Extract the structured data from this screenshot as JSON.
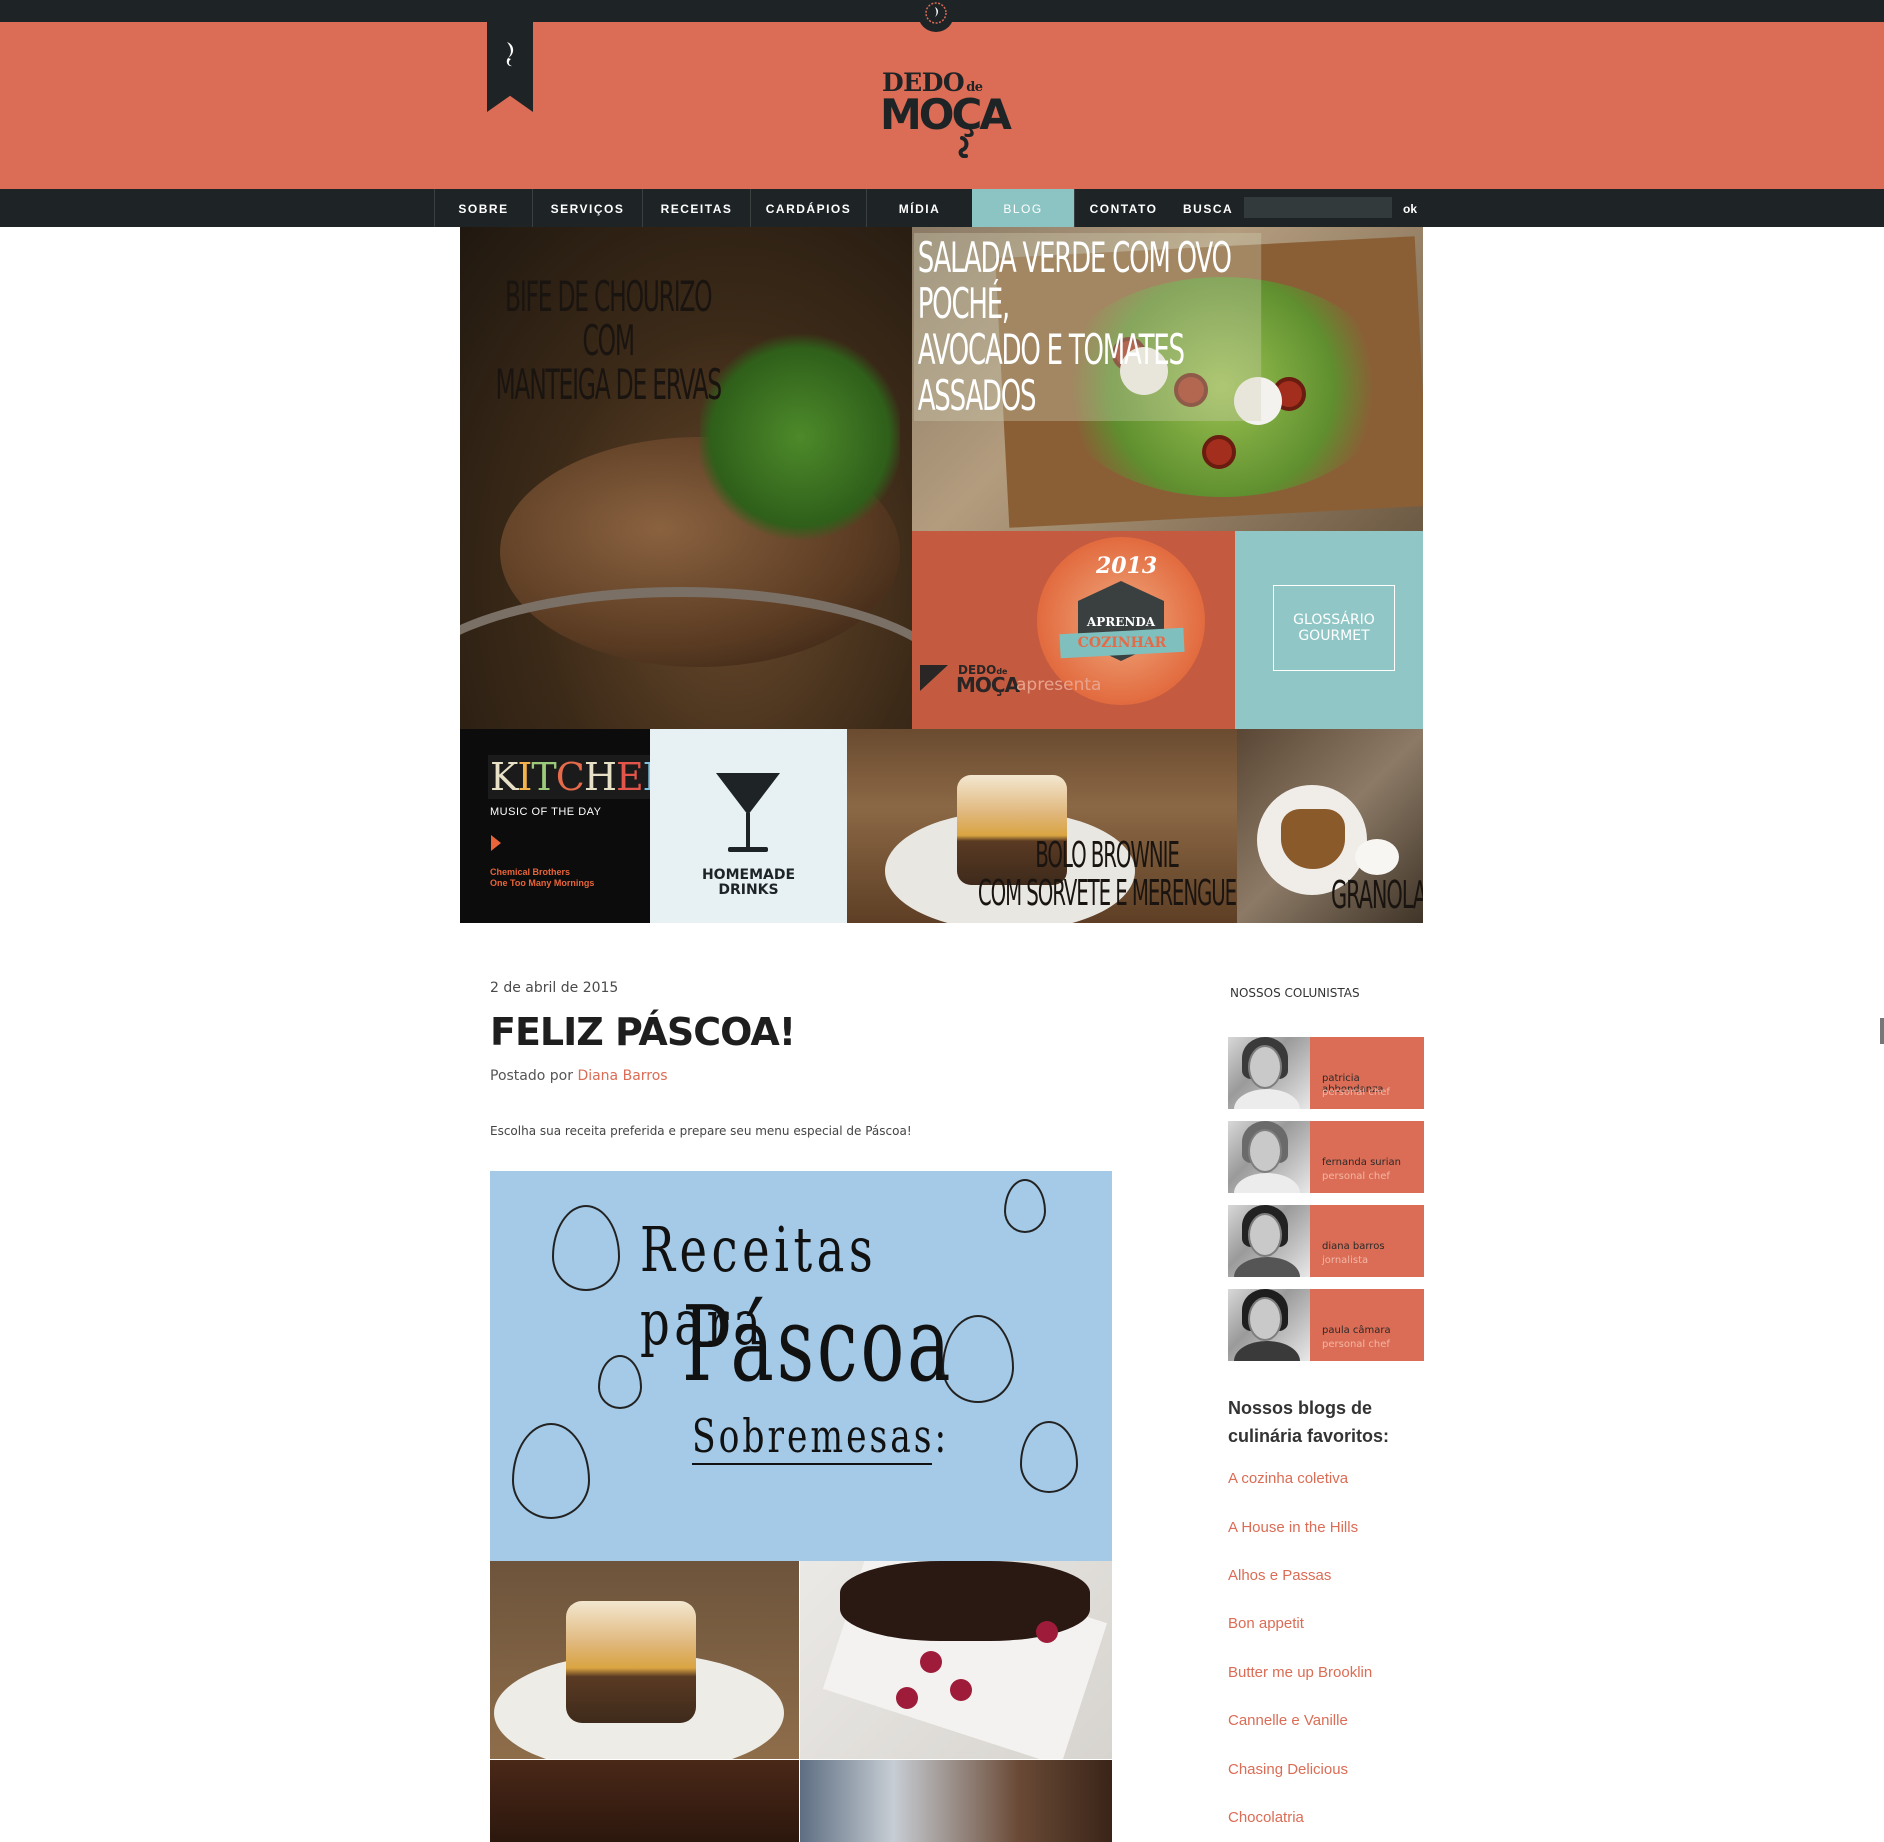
{
  "site": {
    "logo_line1": "DEDO",
    "logo_de": "de",
    "logo_line2": "MOÇA"
  },
  "nav": {
    "items": [
      {
        "label": "SOBRE",
        "active": false
      },
      {
        "label": "SERVIÇOS",
        "active": false
      },
      {
        "label": "RECEITAS",
        "active": false
      },
      {
        "label": "CARDÁPIOS",
        "active": false
      },
      {
        "label": "MÍDIA",
        "active": false
      },
      {
        "label": "BLOG",
        "active": true
      },
      {
        "label": "CONTATO",
        "active": false
      }
    ],
    "search_label": "BUSCA",
    "search_button": "ok",
    "search_value": ""
  },
  "featured": {
    "bife": {
      "title_l1": "BIFE DE CHOURIZO",
      "title_l2": "COM",
      "title_l3": "MANTEIGA DE ERVAS"
    },
    "salada": {
      "title_l1": "SALADA VERDE COM OVO POCHÉ,",
      "title_l2": "AVOCADO E TOMATES ASSADOS"
    },
    "aprenda": {
      "year": "2013",
      "badge_top": "APRENDA",
      "badge_bottom": "COZINHAR",
      "brand_l1": "DEDO",
      "brand_de": "de",
      "brand_l2": "MOÇA",
      "apresenta": "apresenta"
    },
    "glossario": {
      "l1": "GLOSSÁRIO",
      "l2": "GOURMET"
    },
    "kitchen": {
      "title_letters": [
        "K",
        "I",
        "T",
        "C",
        "H",
        "E",
        "N"
      ],
      "subtitle": "MUSIC OF THE DAY",
      "artist": "Chemical Brothers",
      "song": "One Too Many Mornings"
    },
    "drinks": {
      "l1": "HOMEMADE",
      "l2": "DRINKS"
    },
    "bolo": {
      "title_l1": "BOLO BROWNIE",
      "title_l2": "COM SORVETE E MERENGUE"
    },
    "granola": {
      "title": "GRANOLA"
    }
  },
  "post": {
    "date": "2 de abril de 2015",
    "title": "FELIZ PÁSCOA!",
    "posted_by_prefix": "Postado por",
    "author": "Diana Barros",
    "excerpt": "Escolha sua receita preferida e prepare seu menu especial de Páscoa!",
    "promo": {
      "line1": "Receitas para",
      "line2": "Páscoa",
      "line3": "Sobremesas:"
    }
  },
  "sidebar": {
    "columnists_heading": "NOSSOS COLUNISTAS",
    "columnists": [
      {
        "name": "patricia abbondanza",
        "role": "personal chef"
      },
      {
        "name": "fernanda surian",
        "role": "personal chef"
      },
      {
        "name": "diana barros",
        "role": "jornalista"
      },
      {
        "name": "paula câmara",
        "role": "personal chef"
      }
    ],
    "blogs_heading": "Nossos blogs de culinária favoritos:",
    "blogs": [
      "A cozinha coletiva",
      "A House in the Hills",
      "Alhos e Passas",
      "Bon appetit",
      "Butter me up Brooklin",
      "Cannelle e Vanille",
      "Chasing Delicious",
      "Chocolatria"
    ]
  },
  "colors": {
    "brand": "#db6c55",
    "dark": "#1e2326",
    "teal": "#8bc4c3",
    "promo_blue": "#a4cae7"
  }
}
